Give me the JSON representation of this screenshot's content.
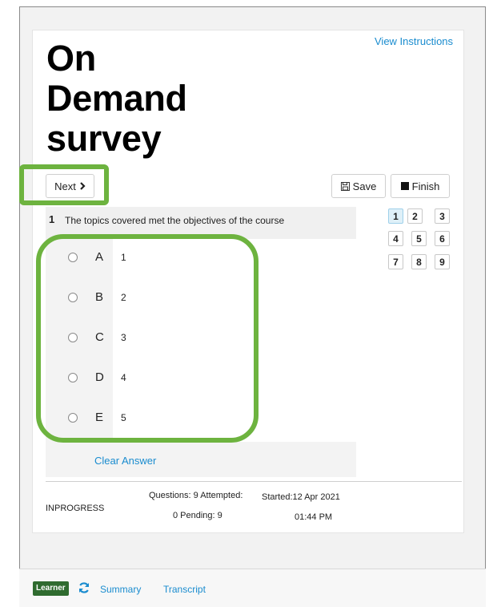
{
  "header": {
    "view_instructions": "View Instructions",
    "title_line1": "On",
    "title_line2": "Demand",
    "title_line3": "survey"
  },
  "toolbar": {
    "next_label": "Next",
    "save_label": "Save",
    "finish_label": "Finish"
  },
  "question": {
    "number": "1",
    "text": "The topics covered met the objectives of the course",
    "options": [
      {
        "letter": "A",
        "value": "1"
      },
      {
        "letter": "B",
        "value": "2"
      },
      {
        "letter": "C",
        "value": "3"
      },
      {
        "letter": "D",
        "value": "4"
      },
      {
        "letter": "E",
        "value": "5"
      }
    ],
    "clear_answer": "Clear Answer"
  },
  "question_nav": [
    "1",
    "2",
    "3",
    "4",
    "5",
    "6",
    "7",
    "8",
    "9"
  ],
  "status": {
    "state": "INPROGRESS",
    "questions_line": "Questions: 9 Attempted:",
    "pending_line": "0 Pending: 9",
    "started_line": "Started:12 Apr 2021",
    "time_line": "01:44 PM"
  },
  "footer": {
    "learner_badge": "Learner",
    "summary": "Summary",
    "transcript": "Transcript"
  },
  "colors": {
    "accent_link": "#1a8ccf",
    "highlight_green": "#6db33f",
    "badge_green": "#2f6b2f",
    "active_question": "#dff0f8"
  },
  "icons": {
    "next": "chevron-right-icon",
    "save": "floppy-disk-icon",
    "finish": "stop-square-icon",
    "refresh": "refresh-icon"
  }
}
